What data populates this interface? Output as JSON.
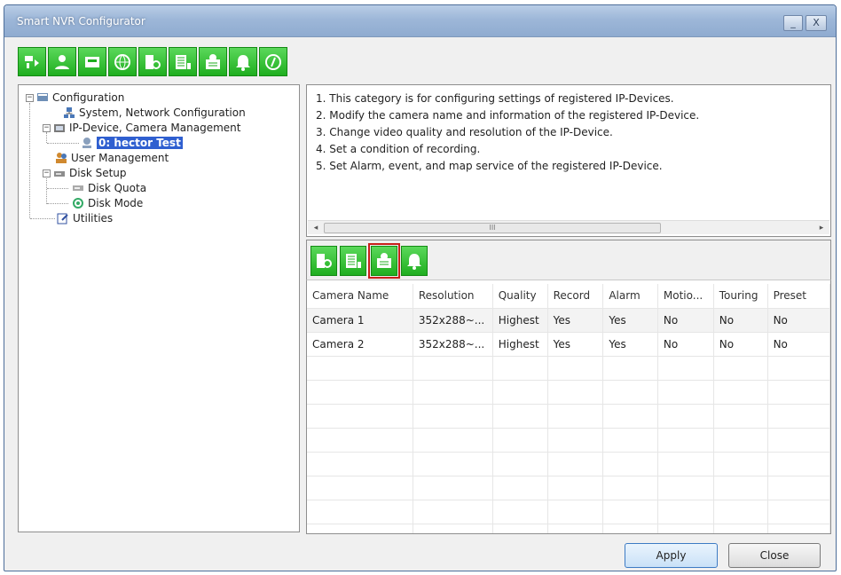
{
  "window": {
    "title": "Smart NVR Configurator",
    "min_label": "_",
    "close_label": "X"
  },
  "toolbar": {
    "buttons": [
      {
        "icon": "device-scan-icon"
      },
      {
        "icon": "user-icon"
      },
      {
        "icon": "disk-icon"
      },
      {
        "icon": "globe-icon"
      },
      {
        "icon": "camera-setup-icon"
      },
      {
        "icon": "recording-icon"
      },
      {
        "icon": "map-icon"
      },
      {
        "icon": "alarm-bell-icon"
      },
      {
        "icon": "info-icon"
      }
    ]
  },
  "tree": {
    "root": "Configuration",
    "system": "System, Network Configuration",
    "ipdevice": "IP-Device, Camera Management",
    "device0": "0: hector Test",
    "user": "User Management",
    "disk": "Disk Setup",
    "quota": "Disk Quota",
    "mode": "Disk Mode",
    "utilities": "Utilities",
    "expanded_marker": "−"
  },
  "info": {
    "lines": [
      "1. This category is for configuring settings of registered IP-Devices.",
      "2. Modify the camera name and information of the registered IP-Device.",
      "3. Change video quality and resolution of the IP-Device.",
      "4. Set a condition of recording.",
      "5. Set Alarm, event, and map service of the registered IP-Device."
    ],
    "scroll_left": "◂",
    "scroll_right": "▸",
    "scroll_grip": "III"
  },
  "subtoolbar": {
    "buttons": [
      {
        "icon": "camera-setup-icon"
      },
      {
        "icon": "recording-icon"
      },
      {
        "icon": "map-icon",
        "active": true
      },
      {
        "icon": "alarm-bell-icon"
      }
    ]
  },
  "grid": {
    "columns": [
      "Camera Name",
      "Resolution",
      "Quality",
      "Record",
      "Alarm",
      "Motio...",
      "Touring",
      "Preset"
    ],
    "rows": [
      [
        "Camera 1",
        "352x288~...",
        "Highest",
        "Yes",
        "Yes",
        "No",
        "No",
        "No"
      ],
      [
        "Camera 2",
        "352x288~...",
        "Highest",
        "Yes",
        "Yes",
        "No",
        "No",
        "No"
      ]
    ]
  },
  "footer": {
    "apply": "Apply",
    "close": "Close"
  },
  "colors": {
    "accent_green": "#1fae1f",
    "selection": "#2f5fd0",
    "highlight_red": "#c8201a"
  }
}
